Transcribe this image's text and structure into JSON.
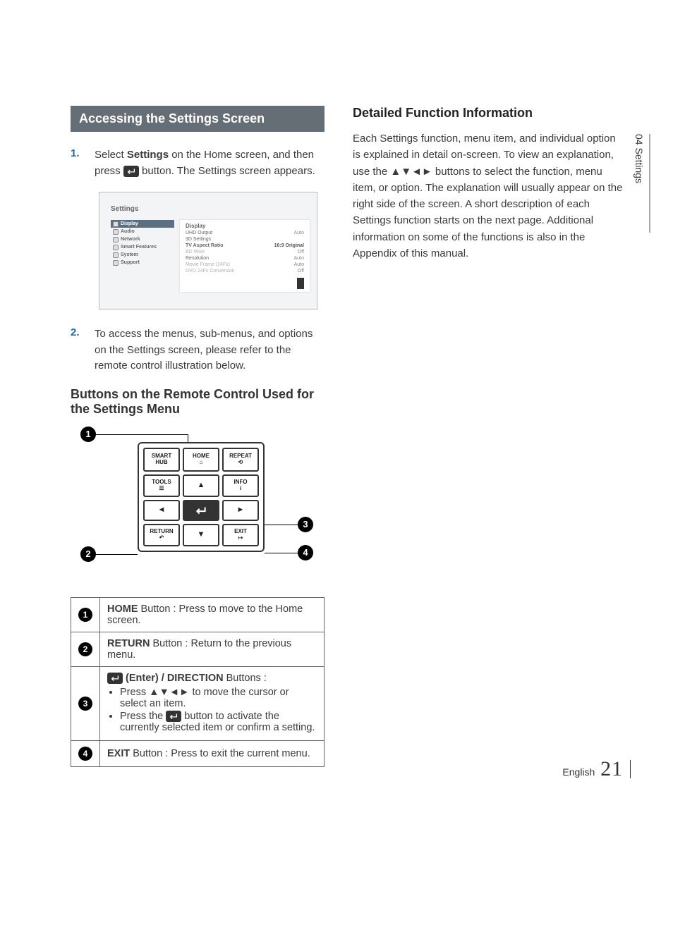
{
  "heading_bar": "Accessing the Settings Screen",
  "step1": {
    "num": "1.",
    "pre": "Select ",
    "bold": "Settings",
    "mid": " on the Home screen, and then press ",
    "post": " button. The Settings screen appears."
  },
  "step2": {
    "num": "2.",
    "text": "To access the menus, sub-menus, and options on the Settings screen, please refer to the remote control illustration below."
  },
  "sub_remote": "Buttons on the Remote Control Used for the Settings Menu",
  "right_sub": "Detailed Function Information",
  "right_body": "Each Settings function, menu item, and individual option is explained in detail on-screen. To view an explanation, use the ▲▼◄► buttons to select the function, menu item, or option. The explanation will usually appear on the right side of the screen. A short description of each Settings function starts on the next page. Additional information on some of the functions is also in the Appendix of this manual.",
  "screenshot": {
    "title": "Settings",
    "side": [
      "Display",
      "Audio",
      "Network",
      "Smart Features",
      "System",
      "Support"
    ],
    "main_title": "Display",
    "rows": [
      {
        "k": "UHD Output",
        "v": "Auto",
        "sel": false,
        "dim": false
      },
      {
        "k": "3D Settings",
        "v": "",
        "sel": false,
        "dim": false
      },
      {
        "k": "TV Aspect Ratio",
        "v": "16:9 Original",
        "sel": true,
        "dim": false
      },
      {
        "k": "BD Wise",
        "v": "Off",
        "sel": false,
        "dim": true
      },
      {
        "k": "Resolution",
        "v": "Auto",
        "sel": false,
        "dim": false
      },
      {
        "k": "Movie Frame (24Fs)",
        "v": "Auto",
        "sel": false,
        "dim": true
      },
      {
        "k": "DVD 24Fs Conversion",
        "v": "Off",
        "sel": false,
        "dim": true
      }
    ]
  },
  "remote": {
    "smart1": "SMART",
    "smart2": "HUB",
    "home": "HOME",
    "repeat": "REPEAT",
    "tools": "TOOLS",
    "info": "INFO",
    "return": "RETURN",
    "exit": "EXIT"
  },
  "callouts": {
    "c1": "1",
    "c2": "2",
    "c3": "3",
    "c4": "4"
  },
  "table": {
    "r1_bold": "HOME",
    "r1_rest": " Button : Press to move to the Home screen.",
    "r2_bold": "RETURN",
    "r2_rest": " Button : Return to the previous menu.",
    "r3_lead1": " (Enter) / DIRECTION",
    "r3_lead2": " Buttons :",
    "r3_b1": "Press ▲▼◄► to move the cursor or select an item.",
    "r3_b2a": "Press the ",
    "r3_b2b": " button to activate the currently selected item or confirm a setting.",
    "r4_bold": "EXIT",
    "r4_rest": " Button : Press to exit the current menu."
  },
  "side_tab": "04  Settings",
  "footer_lang": "English",
  "footer_page": "21"
}
